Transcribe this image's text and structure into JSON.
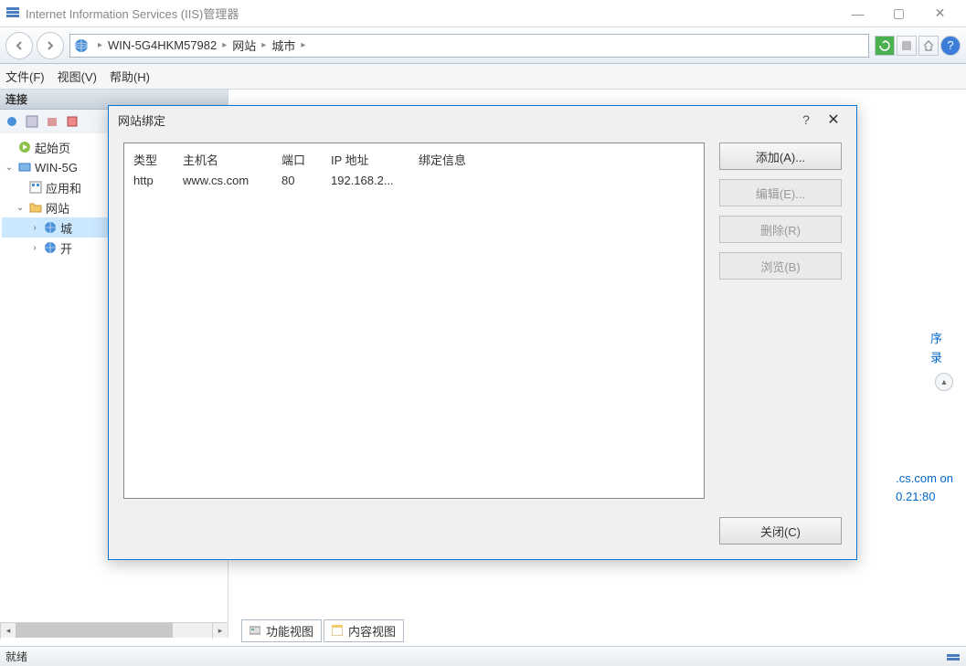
{
  "window": {
    "title": "Internet Information Services (IIS)管理器",
    "breadcrumb": {
      "server": "WIN-5G4HKM57982",
      "sites": "网站",
      "site": "城市"
    }
  },
  "menus": {
    "file": "文件(F)",
    "view": "视图(V)",
    "help": "帮助(H)"
  },
  "sidebar": {
    "header": "连接",
    "nodes": {
      "start": "起始页",
      "server": "WIN-5G",
      "apppools": "应用和",
      "sites": "网站",
      "site1": "城",
      "site2": "开"
    }
  },
  "right": {
    "link1": "序",
    "link2": "录",
    "text1": ".cs.com on",
    "text2": "0.21:80"
  },
  "tabs": {
    "features": "功能视图",
    "content": "内容视图"
  },
  "status": {
    "ready": "就绪"
  },
  "dialog": {
    "title": "网站绑定",
    "headers": {
      "type": "类型",
      "host": "主机名",
      "port": "端口",
      "ip": "IP 地址",
      "bindinfo": "绑定信息"
    },
    "row": {
      "type": "http",
      "host": "www.cs.com",
      "port": "80",
      "ip": "192.168.2..."
    },
    "buttons": {
      "add": "添加(A)...",
      "edit": "编辑(E)...",
      "remove": "删除(R)",
      "browse": "浏览(B)",
      "close": "关闭(C)"
    }
  }
}
